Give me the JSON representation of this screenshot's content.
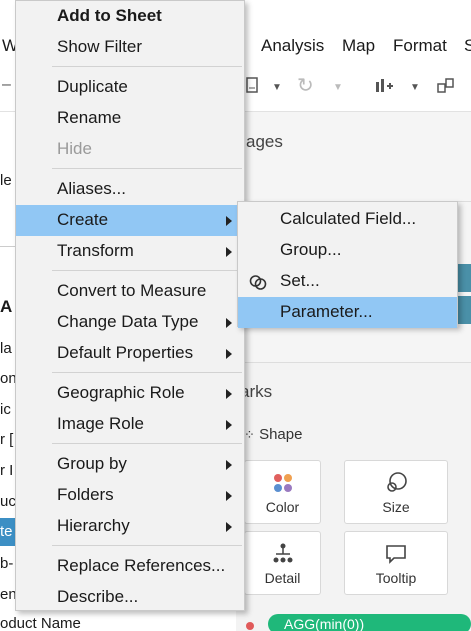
{
  "menubar": {
    "items": [
      "Analysis",
      "Map",
      "Format",
      "S"
    ],
    "left_partial": "W"
  },
  "left_pane": {
    "fragments": [
      "le",
      "A",
      "la",
      "on",
      "ic",
      "r [",
      "r I",
      "uc",
      "te",
      "b-",
      "en",
      "oduct Name"
    ]
  },
  "pages": {
    "label": "ages"
  },
  "marks": {
    "label": "arks",
    "shape_label": "Shape",
    "cards": [
      {
        "caption": "Color",
        "icon": "color-dots-icon"
      },
      {
        "caption": "Size",
        "icon": "size-icon"
      },
      {
        "caption": "Detail",
        "icon": "detail-icon"
      },
      {
        "caption": "Tooltip",
        "icon": "tooltip-icon"
      }
    ],
    "pill_text": "AGG(min(0))"
  },
  "context_menu": {
    "items": [
      {
        "label": "Add to Sheet",
        "bold": true
      },
      {
        "label": "Show Filter"
      },
      {
        "label": "Duplicate"
      },
      {
        "label": "Rename"
      },
      {
        "label": "Hide",
        "disabled": true
      },
      {
        "label": "Aliases..."
      },
      {
        "label": "Create",
        "submenu": true,
        "highlighted": true
      },
      {
        "label": "Transform",
        "submenu": true
      },
      {
        "label": "Convert to Measure"
      },
      {
        "label": "Change Data Type",
        "submenu": true
      },
      {
        "label": "Default Properties",
        "submenu": true
      },
      {
        "label": "Geographic Role",
        "submenu": true
      },
      {
        "label": "Image Role",
        "submenu": true
      },
      {
        "label": "Group by",
        "submenu": true
      },
      {
        "label": "Folders",
        "submenu": true
      },
      {
        "label": "Hierarchy",
        "submenu": true
      },
      {
        "label": "Replace References..."
      },
      {
        "label": "Describe..."
      }
    ]
  },
  "create_submenu": {
    "items": [
      {
        "label": "Calculated Field..."
      },
      {
        "label": "Group..."
      },
      {
        "label": "Set...",
        "icon": "set-icon"
      },
      {
        "label": "Parameter...",
        "highlighted": true
      }
    ]
  },
  "colors": {
    "highlight": "#91c7f4",
    "menu_bg": "#f2f2f2",
    "pill_green": "#1fb87a",
    "shelf_teal": "#4a90a8"
  }
}
